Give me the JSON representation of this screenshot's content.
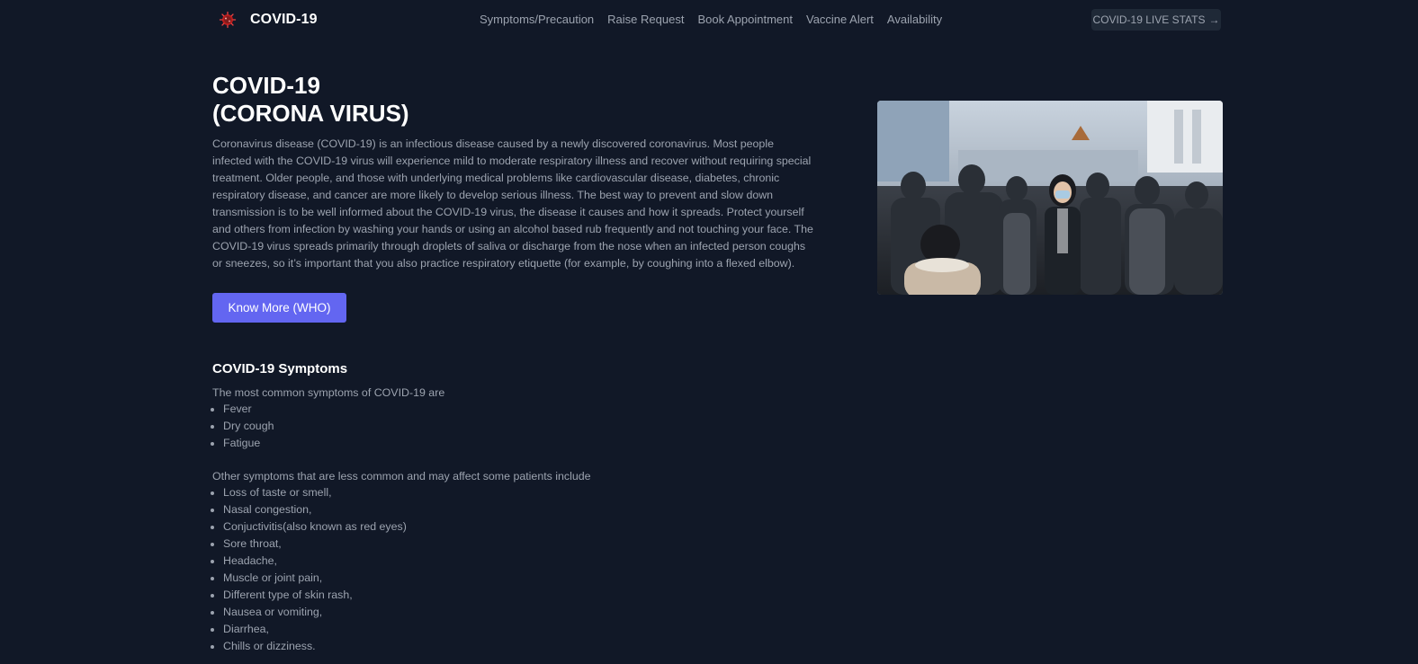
{
  "header": {
    "brand": "COVID-19",
    "nav": [
      "Symptoms/Precaution",
      "Raise Request",
      "Book Appointment",
      "Vaccine Alert",
      "Availability"
    ],
    "live_stats_label": "COVID-19 LIVE STATS",
    "live_stats_icon": "arrow-right-icon"
  },
  "hero": {
    "title_line1": "COVID-19",
    "title_line2": "(CORONA VIRUS)",
    "description": "Coronavirus disease (COVID-19) is an infectious disease caused by a newly discovered coronavirus. Most people infected with the COVID-19 virus will experience mild to moderate respiratory illness and recover without requiring special treatment. Older people, and those with underlying medical problems like cardiovascular disease, diabetes, chronic respiratory disease, and cancer are more likely to develop serious illness. The best way to prevent and slow down transmission is to be well informed about the COVID-19 virus, the disease it causes and how it spreads. Protect yourself and others from infection by washing your hands or using an alcohol based rub frequently and not touching your face. The COVID-19 virus spreads primarily through droplets of saliva or discharge from the nose when an infected person coughs or sneezes, so it’s important that you also practice respiratory etiquette (for example, by coughing into a flexed elbow).",
    "button_label": "Know More (WHO)"
  },
  "symptoms": {
    "title": "COVID-19 Symptoms",
    "common_intro": "The most common symptoms of COVID-19 are",
    "common": [
      "Fever",
      "Dry cough",
      "Fatigue"
    ],
    "other_intro": "Other symptoms that are less common and may affect some patients include",
    "other": [
      "Loss of taste or smell,",
      "Nasal congestion,",
      "Conjuctivitis(also known as red eyes)",
      "Sore throat,",
      "Headache,",
      "Muscle or joint pain,",
      "Different type of skin rash,",
      "Nausea or vomiting,",
      "Diarrhea,",
      "Chills or dizziness."
    ]
  },
  "colors": {
    "background": "#111827",
    "accent": "#6366f1",
    "text": "#9ca3af",
    "heading": "#ffffff"
  }
}
